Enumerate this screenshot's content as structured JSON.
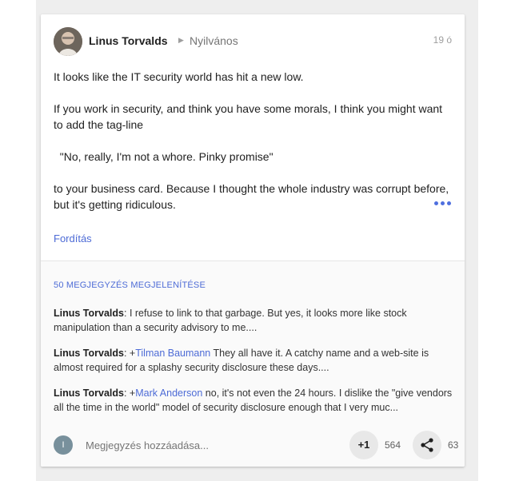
{
  "post": {
    "author": "Linus Torvalds",
    "visibility": "Nyilvános",
    "time": "19 ó",
    "paragraphs": [
      "It looks like the IT security world has hit a new low.",
      "If you work in security, and think you have some morals, I think you might want to add the tag-line",
      "  \"No, really, I'm not a whore. Pinky promise\"",
      "to your business card. Because I thought the whole industry was corrupt before, but it's getting ridiculous."
    ],
    "translate_label": "Fordítás"
  },
  "comments": {
    "show_label": "50 MEGJEGYZÉS MEGJELENÍTÉSE",
    "items": [
      {
        "author": "Linus Torvalds",
        "prefix": ": ",
        "mention": "",
        "text": "I refuse to link to that garbage. But yes, it looks more like stock manipulation than a security advisory to me...."
      },
      {
        "author": "Linus Torvalds",
        "prefix": ": +",
        "mention": "Tilman Baumann",
        "text": " They all have it. A catchy name and a web-site is almost required for a splashy security disclosure these days...."
      },
      {
        "author": "Linus Torvalds",
        "prefix": ": +",
        "mention": "Mark Anderson",
        "text": " no, it's not even the 24 hours. I dislike the \"give vendors all the time in the world\" model of security disclosure enough that I very muc..."
      }
    ]
  },
  "footer": {
    "user_initial": "I",
    "add_comment_placeholder": "Megjegyzés hozzáadása...",
    "plus_label": "+1",
    "plus_count": "564",
    "share_count": "63"
  },
  "colors": {
    "accent": "#4d6bd6"
  },
  "icons": {
    "visibility_arrow": "arrow-right-icon",
    "more": "more-horizontal-icon",
    "share": "share-icon"
  }
}
